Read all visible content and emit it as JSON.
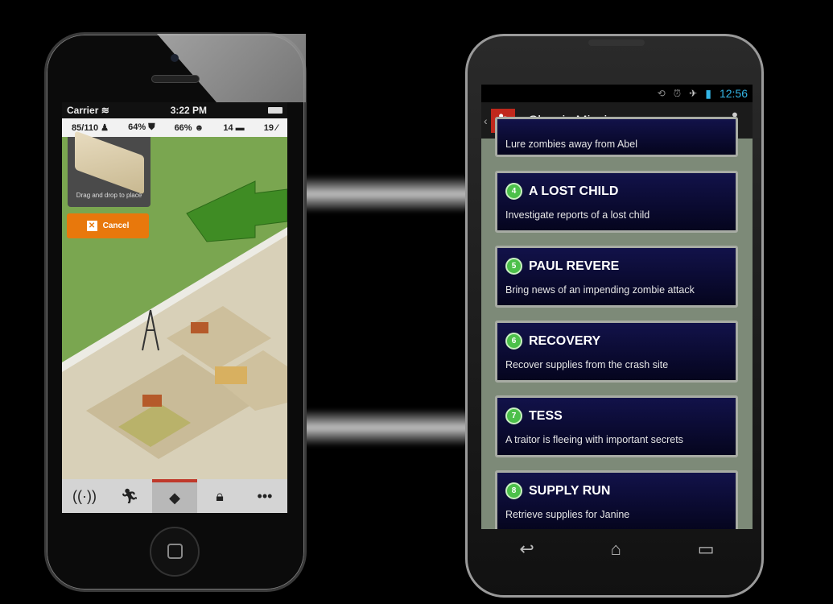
{
  "iphone": {
    "status": {
      "carrier": "Carrier",
      "time": "3:22 PM"
    },
    "stats": [
      {
        "value": "85/110",
        "icon": "survivor-icon"
      },
      {
        "value": "64%",
        "icon": "shield-icon"
      },
      {
        "value": "66%",
        "icon": "zombie-icon"
      },
      {
        "value": "14",
        "icon": "ammo-icon"
      },
      {
        "value": "19",
        "icon": "tool-icon"
      }
    ],
    "panel_text": "Drag and drop to place",
    "cancel_label": "Cancel",
    "tabs": [
      {
        "icon": "radio-tower-icon"
      },
      {
        "icon": "running-man-icon"
      },
      {
        "icon": "base-icon",
        "selected": true
      },
      {
        "icon": "shop-bag-icon"
      },
      {
        "icon": "more-icon"
      }
    ]
  },
  "android": {
    "status": {
      "time": "12:56"
    },
    "title": "Classic Missions",
    "partial_mission": "Lure zombies away from Abel",
    "missions": [
      {
        "number": "4",
        "title": "A LOST CHILD",
        "desc": "Investigate reports of a lost child"
      },
      {
        "number": "5",
        "title": "PAUL REVERE",
        "desc": "Bring news of an impending zombie attack"
      },
      {
        "number": "6",
        "title": "RECOVERY",
        "desc": "Recover supplies from the crash site"
      },
      {
        "number": "7",
        "title": "TESS",
        "desc": "A traitor is fleeing with important secrets"
      },
      {
        "number": "8",
        "title": "SUPPLY RUN",
        "desc": "Retrieve supplies for Janine"
      }
    ]
  }
}
